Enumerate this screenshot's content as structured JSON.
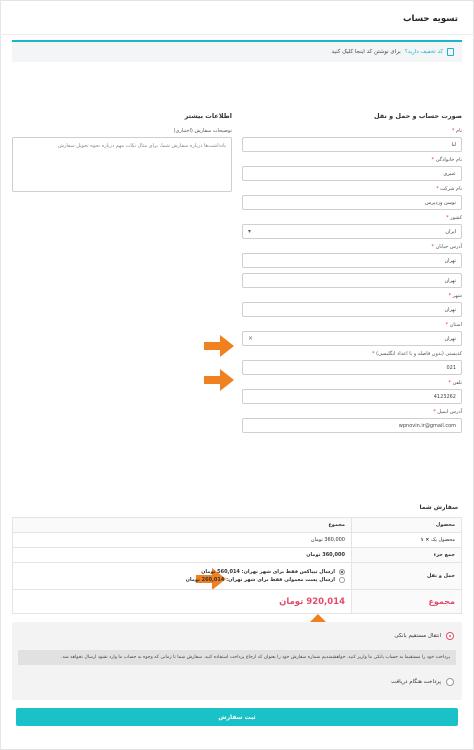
{
  "page_title": "تسویه حساب",
  "coupon": {
    "question": "کد تخفیف دارید؟",
    "link": "برای نوشتن کد اینجا کلیک کنید"
  },
  "billing": {
    "heading": "صورت حساب و حمل و نقل",
    "fields": [
      {
        "label": "نام",
        "value": "لنا"
      },
      {
        "label": "نام خانوادگی",
        "value": "عنبری"
      },
      {
        "label": "نام شرکت",
        "value": "توسن وردپرس"
      },
      {
        "label": "کشور",
        "value": "ایران"
      },
      {
        "label": "آدرس خیابان",
        "value": "تهران"
      },
      {
        "label": "",
        "value": "تهران"
      },
      {
        "label": "شهر",
        "value": "تهران"
      },
      {
        "label": "استان",
        "value": "تهران"
      },
      {
        "label": "کدپستی (بدون فاصله و با اعداد انگلیسی)",
        "value": "021"
      },
      {
        "label": "تلفن",
        "value": "4123262"
      },
      {
        "label": "آدرس ایمیل",
        "value": "wpnovin.ir@gmail.com"
      }
    ],
    "required_mark": "*",
    "select_clear": "×"
  },
  "additional": {
    "heading": "اطلاعات بیشتر",
    "notes_label": "توضیحات سفارش (اختیاری)",
    "notes_placeholder": "یادداشت‌ها درباره سفارش شما، برای مثال نکات مهم درباره نحوه تحویل سفارش"
  },
  "order": {
    "title": "سفارش شما",
    "col_product": "محصول",
    "col_total": "مجموع",
    "item_name": "محصول یک",
    "item_qty": "× ۱",
    "item_total": "360,000 تومان",
    "subtotal_label": "جمع جزء",
    "subtotal_value": "360,000 تومان",
    "shipping_label": "حمل و نقل",
    "shipping_options": [
      "ارسال تیپاکس فقط برای شهر تهران: 560,014 تومان",
      "ارسال پست معمولی فقط برای شهر تهران: 260,014 تومان"
    ],
    "total_label": "مجموع",
    "total_value": "920,014 تومان"
  },
  "payment": {
    "options": [
      "انتقال مستقیم بانکی",
      "پرداخت هنگام دریافت"
    ],
    "desc": "پرداخت خود را مستقیما به حساب بانکی ما واریز کنید. خواهشمندیم شماره سفارش خود را بعنوان کد ارجاع پرداخت استفاده کنید. سفارش شما تا زمانی که وجوه به حساب ما وارد نشود ارسال نخواهد شد.",
    "submit": "ثبت سفارش"
  },
  "colors": {
    "accent": "#1bb6c9",
    "total": "#e24c6a",
    "arrow": "#f08020"
  }
}
